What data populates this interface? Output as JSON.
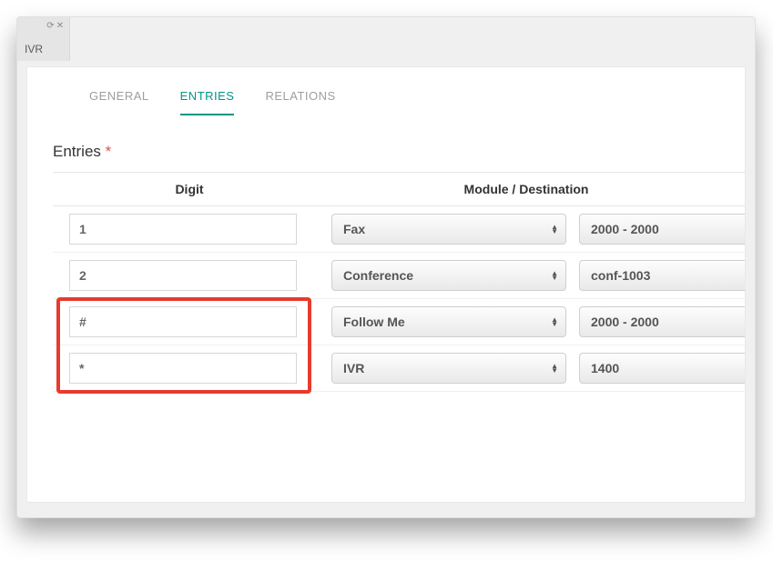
{
  "window": {
    "tab_label": "IVR"
  },
  "tabs": {
    "general": "GENERAL",
    "entries": "ENTRIES",
    "relations": "RELATIONS",
    "active": "entries"
  },
  "section": {
    "title": "Entries",
    "required_marker": "*"
  },
  "columns": {
    "digit": "Digit",
    "module_destination": "Module / Destination"
  },
  "rows": [
    {
      "digit": "1",
      "module": "Fax",
      "destination": "2000 - 2000"
    },
    {
      "digit": "2",
      "module": "Conference",
      "destination": "conf-1003"
    },
    {
      "digit": "#",
      "module": "Follow Me",
      "destination": "2000 - 2000"
    },
    {
      "digit": "*",
      "module": "IVR",
      "destination": "1400"
    }
  ]
}
